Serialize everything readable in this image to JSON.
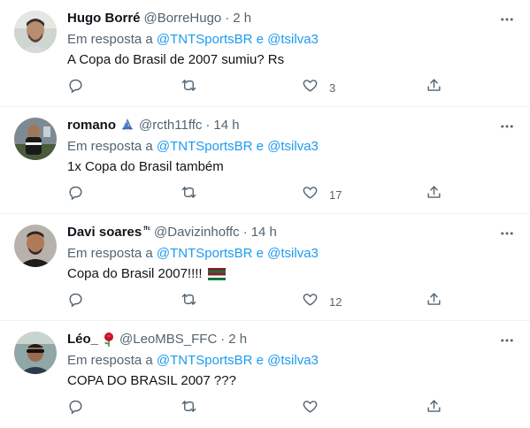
{
  "tweets": [
    {
      "name": "Hugo Borré",
      "handle": "@BorreHugo",
      "time": "2 h",
      "reply_prefix": "Em resposta a",
      "reply_to_1": "@TNTSportsBR",
      "reply_and": "e",
      "reply_to_2": "@tsilva3",
      "text": "A Copa do Brasil de 2007 sumiu? Rs",
      "likes": "3"
    },
    {
      "name": "romano",
      "name_emoji": "wizard-emoji",
      "handle": "@rcth11ffc",
      "time": "14 h",
      "reply_prefix": "Em resposta a",
      "reply_to_1": "@TNTSportsBR",
      "reply_and": "e",
      "reply_to_2": "@tsilva3",
      "text": "1x Copa do Brasil também",
      "likes": "17"
    },
    {
      "name": "Davi soares",
      "name_suffix": "ᶠᶠᶜ",
      "handle": "@Davizinhoffc",
      "time": "14 h",
      "reply_prefix": "Em resposta a",
      "reply_to_1": "@TNTSportsBR",
      "reply_and": "e",
      "reply_to_2": "@tsilva3",
      "text": "Copa do Brasil 2007!!!!",
      "text_emoji": "flag-emoji",
      "likes": "12"
    },
    {
      "name": "Léo_",
      "name_emoji": "rose-emoji",
      "handle": "@LeoMBS_FFC",
      "time": "2 h",
      "reply_prefix": "Em resposta a",
      "reply_to_1": "@TNTSportsBR",
      "reply_and": "e",
      "reply_to_2": "@tsilva3",
      "text": "COPA DO BRASIL 2007 ???",
      "likes": ""
    }
  ],
  "separator": "·",
  "colors": {
    "text": "#0f1419",
    "secondary": "#536471",
    "link": "#1d9bf0",
    "border": "#eff3f4"
  },
  "icons": [
    "reply-icon",
    "retweet-icon",
    "like-icon",
    "share-icon",
    "more-icon"
  ]
}
